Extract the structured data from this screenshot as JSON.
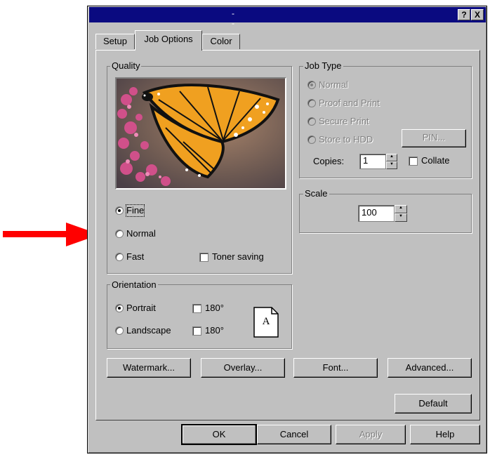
{
  "window": {
    "title": "- -",
    "help_label": "?",
    "close_label": "X"
  },
  "tabs": [
    {
      "label": "Setup"
    },
    {
      "label": "Job Options"
    },
    {
      "label": "Color"
    }
  ],
  "quality": {
    "legend": "Quality",
    "options": [
      "Fine",
      "Normal",
      "Fast"
    ],
    "selected": "Fine",
    "toner_saving_label": "Toner saving",
    "toner_saving_checked": false
  },
  "job_type": {
    "legend": "Job Type",
    "options": [
      "Normal",
      "Proof and Print",
      "Secure Print",
      "Store to HDD"
    ],
    "selected": "Normal",
    "pin_label": "PIN...",
    "copies_label": "Copies:",
    "copies_value": "1",
    "collate_label": "Collate",
    "collate_checked": false
  },
  "scale": {
    "legend": "Scale",
    "value": "100"
  },
  "orientation": {
    "legend": "Orientation",
    "portrait_label": "Portrait",
    "landscape_label": "Landscape",
    "selected": "Portrait",
    "rotate_portrait_label": "180°",
    "rotate_landscape_label": "180°",
    "page_icon_letter": "A"
  },
  "buttons": {
    "watermark": "Watermark...",
    "overlay": "Overlay...",
    "font": "Font...",
    "advanced": "Advanced...",
    "default": "Default",
    "ok": "OK",
    "cancel": "Cancel",
    "apply": "Apply",
    "help": "Help"
  },
  "colors": {
    "title_bar": "#0a0a80",
    "dialog_face": "#c0c0c0",
    "arrow": "#ff0000"
  }
}
